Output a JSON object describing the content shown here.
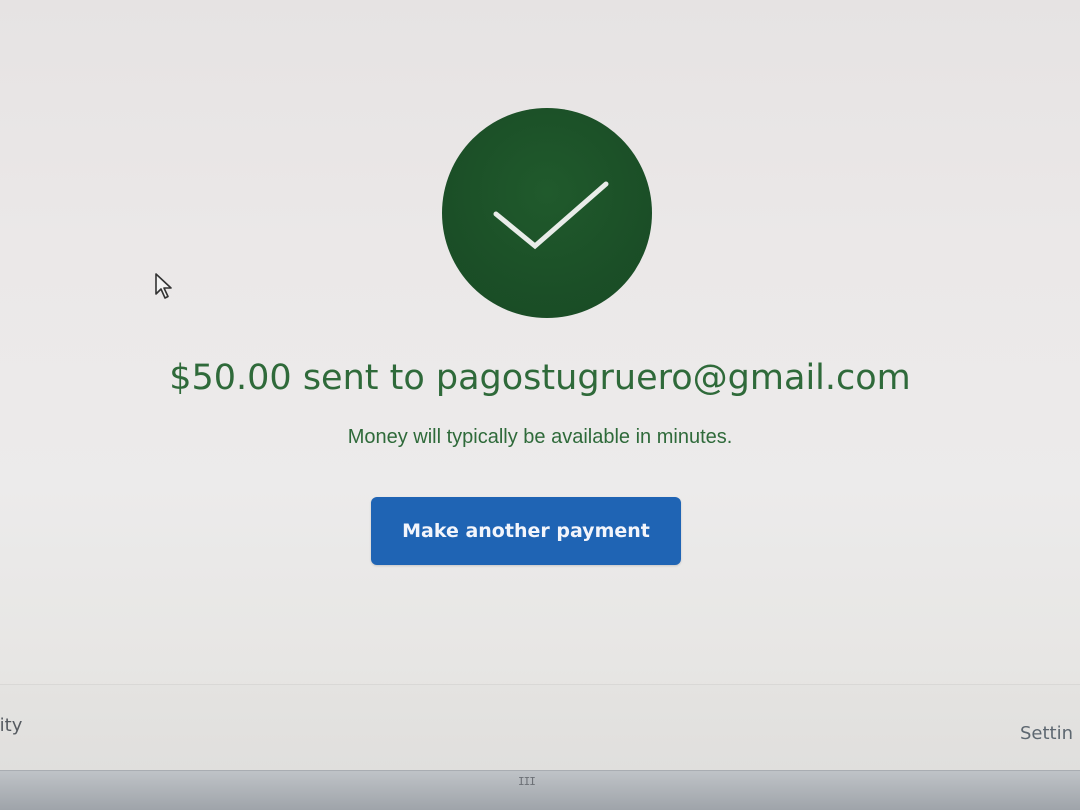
{
  "confirmation": {
    "headline": "$50.00 sent to pagostugruero@gmail.com",
    "subtext": "Money will typically be available in minutes.",
    "button_label": "Make another payment",
    "status_icon": "checkmark-icon",
    "accent_color": "#1b4f27",
    "button_color": "#1f64b4"
  },
  "nav": {
    "left_item": "ivity",
    "right_item": "Settin"
  },
  "taskbar": {
    "grip": "III"
  }
}
